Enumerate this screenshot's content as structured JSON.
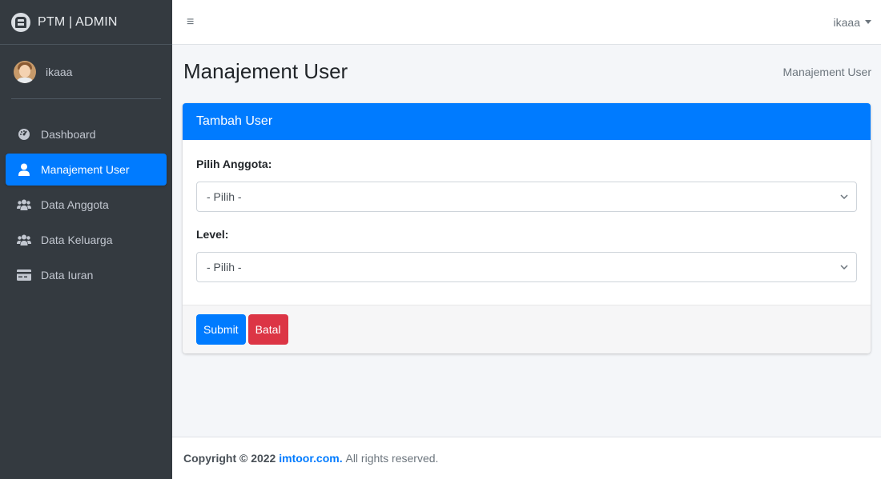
{
  "brand": {
    "title": "PTM | ADMIN"
  },
  "user_panel": {
    "name": "ikaaa"
  },
  "sidebar": {
    "items": [
      {
        "label": "Dashboard",
        "icon": "dashboard-icon",
        "active": false
      },
      {
        "label": "Manajement User",
        "icon": "user-icon",
        "active": true
      },
      {
        "label": "Data Anggota",
        "icon": "users-icon",
        "active": false
      },
      {
        "label": "Data Keluarga",
        "icon": "users-icon",
        "active": false
      },
      {
        "label": "Data Iuran",
        "icon": "credit-card-icon",
        "active": false
      }
    ]
  },
  "navbar": {
    "menu_icon": "≡",
    "user": "ikaaa"
  },
  "header": {
    "title": "Manajement User",
    "breadcrumb": "Manajement User"
  },
  "card": {
    "title": "Tambah User",
    "fields": [
      {
        "label": "Pilih Anggota:",
        "value": "- Pilih -"
      },
      {
        "label": "Level:",
        "value": "- Pilih -"
      }
    ],
    "submit_label": "Submit",
    "cancel_label": "Batal"
  },
  "footer": {
    "prefix": "Copyright © 2022",
    "link": "imtoor.com.",
    "suffix": "All rights reserved."
  },
  "colors": {
    "primary": "#007bff",
    "danger": "#dc3545",
    "sidebar": "#343a40"
  }
}
